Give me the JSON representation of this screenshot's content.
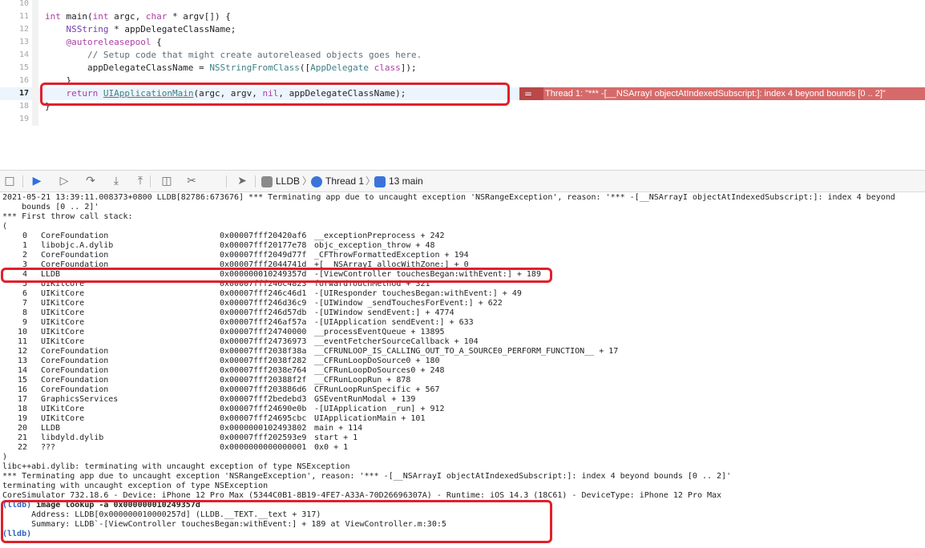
{
  "editor": {
    "lines": [
      {
        "n": "10",
        "parts": []
      },
      {
        "n": "11",
        "parts": [
          {
            "t": "int ",
            "c": "kw"
          },
          {
            "t": "main(",
            "c": "pl"
          },
          {
            "t": "int ",
            "c": "kw"
          },
          {
            "t": "argc, ",
            "c": "pl"
          },
          {
            "t": "char ",
            "c": "kw"
          },
          {
            "t": "* argv[]) {",
            "c": "pl"
          }
        ]
      },
      {
        "n": "12",
        "parts": [
          {
            "t": "    ",
            "c": "pl"
          },
          {
            "t": "NSString",
            "c": "cls"
          },
          {
            "t": " * appDelegateClassName;",
            "c": "pl"
          }
        ]
      },
      {
        "n": "13",
        "parts": [
          {
            "t": "    ",
            "c": "pl"
          },
          {
            "t": "@autoreleasepool",
            "c": "kw"
          },
          {
            "t": " {",
            "c": "pl"
          }
        ]
      },
      {
        "n": "14",
        "parts": [
          {
            "t": "        ",
            "c": "pl"
          },
          {
            "t": "// Setup code that might create autoreleased objects goes here.",
            "c": "cm"
          }
        ]
      },
      {
        "n": "15",
        "parts": [
          {
            "t": "        appDelegateClassName = ",
            "c": "pl"
          },
          {
            "t": "NSStringFromClass",
            "c": "fn"
          },
          {
            "t": "([",
            "c": "pl"
          },
          {
            "t": "AppDelegate",
            "c": "ty"
          },
          {
            "t": " ",
            "c": "pl"
          },
          {
            "t": "class",
            "c": "kw"
          },
          {
            "t": "]);",
            "c": "pl"
          }
        ]
      },
      {
        "n": "16",
        "parts": [
          {
            "t": "    }",
            "c": "pl"
          }
        ]
      },
      {
        "n": "17",
        "parts": [
          {
            "t": "    ",
            "c": "pl"
          },
          {
            "t": "return ",
            "c": "kw"
          },
          {
            "t": "UIApplicationMain",
            "c": "fn und"
          },
          {
            "t": "(argc, argv, ",
            "c": "pl"
          },
          {
            "t": "nil",
            "c": "kw"
          },
          {
            "t": ", appDelegateClassName);",
            "c": "pl"
          }
        ],
        "current": true
      },
      {
        "n": "18",
        "parts": [
          {
            "t": "}",
            "c": "pl"
          }
        ]
      },
      {
        "n": "19",
        "parts": []
      }
    ],
    "error_icon": "=",
    "error_message": "Thread 1: \"*** -[__NSArrayI objectAtIndexedSubscript:]: index 4 beyond bounds [0 .. 2]\""
  },
  "debugbar": {
    "buttons": [
      {
        "name": "hide-debug-area-button",
        "glyph": "□"
      },
      {
        "name": "breakpoints-toggle-button",
        "glyph": "▶"
      },
      {
        "name": "continue-button",
        "glyph": "▷"
      },
      {
        "name": "step-over-button",
        "glyph": "↷"
      },
      {
        "name": "step-into-button",
        "glyph": "⤓"
      },
      {
        "name": "step-out-button",
        "glyph": "⤒"
      },
      {
        "name": "debug-view-hierarchy-button",
        "glyph": "◫"
      },
      {
        "name": "memory-graph-button",
        "glyph": "✂"
      },
      {
        "name": "simulate-location-button",
        "glyph": "➤"
      }
    ],
    "crumbs": {
      "target": "LLDB",
      "thread": "Thread 1",
      "frame": "13 main"
    },
    "colors": {
      "thread_icon": "#3a74d9",
      "frame_icon": "#3a74d9",
      "target_icon": "#8a8a8a"
    }
  },
  "console": {
    "header_lines": [
      "2021-05-21 13:39:11.008373+0800 LLDB[82786:673676] *** Terminating app due to uncaught exception 'NSRangeException', reason: '*** -[__NSArrayI objectAtIndexedSubscript:]: index 4 beyond",
      "    bounds [0 .. 2]'",
      "*** First throw call stack:",
      "("
    ],
    "frames": [
      {
        "idx": "0",
        "lib": "CoreFoundation",
        "addr": "0x00007fff20420af6",
        "sym": "__exceptionPreprocess + 242"
      },
      {
        "idx": "1",
        "lib": "libobjc.A.dylib",
        "addr": "0x00007fff20177e78",
        "sym": "objc_exception_throw + 48"
      },
      {
        "idx": "2",
        "lib": "CoreFoundation",
        "addr": "0x00007fff2049d77f",
        "sym": "_CFThrowFormattedException + 194"
      },
      {
        "idx": "3",
        "lib": "CoreFoundation",
        "addr": "0x00007fff2044741d",
        "sym": "+[__NSArrayI allocWithZone:] + 0"
      },
      {
        "idx": "4",
        "lib": "LLDB",
        "addr": "0x000000010249357d",
        "sym": "-[ViewController touchesBegan:withEvent:] + 189"
      },
      {
        "idx": "5",
        "lib": "UIKitCore",
        "addr": "0x00007fff246c4823",
        "sym": "forwardTouchMethod + 321"
      },
      {
        "idx": "6",
        "lib": "UIKitCore",
        "addr": "0x00007fff246c46d1",
        "sym": "-[UIResponder touchesBegan:withEvent:] + 49"
      },
      {
        "idx": "7",
        "lib": "UIKitCore",
        "addr": "0x00007fff246d36c9",
        "sym": "-[UIWindow _sendTouchesForEvent:] + 622"
      },
      {
        "idx": "8",
        "lib": "UIKitCore",
        "addr": "0x00007fff246d57db",
        "sym": "-[UIWindow sendEvent:] + 4774"
      },
      {
        "idx": "9",
        "lib": "UIKitCore",
        "addr": "0x00007fff246af57a",
        "sym": "-[UIApplication sendEvent:] + 633"
      },
      {
        "idx": "10",
        "lib": "UIKitCore",
        "addr": "0x00007fff24740000",
        "sym": "__processEventQueue + 13895"
      },
      {
        "idx": "11",
        "lib": "UIKitCore",
        "addr": "0x00007fff24736973",
        "sym": "__eventFetcherSourceCallback + 104"
      },
      {
        "idx": "12",
        "lib": "CoreFoundation",
        "addr": "0x00007fff2038f38a",
        "sym": "__CFRUNLOOP_IS_CALLING_OUT_TO_A_SOURCE0_PERFORM_FUNCTION__ + 17"
      },
      {
        "idx": "13",
        "lib": "CoreFoundation",
        "addr": "0x00007fff2038f282",
        "sym": "__CFRunLoopDoSource0 + 180"
      },
      {
        "idx": "14",
        "lib": "CoreFoundation",
        "addr": "0x00007fff2038e764",
        "sym": "__CFRunLoopDoSources0 + 248"
      },
      {
        "idx": "15",
        "lib": "CoreFoundation",
        "addr": "0x00007fff20388f2f",
        "sym": "__CFRunLoopRun + 878"
      },
      {
        "idx": "16",
        "lib": "CoreFoundation",
        "addr": "0x00007fff203886d6",
        "sym": "CFRunLoopRunSpecific + 567"
      },
      {
        "idx": "17",
        "lib": "GraphicsServices",
        "addr": "0x00007fff2bedebd3",
        "sym": "GSEventRunModal + 139"
      },
      {
        "idx": "18",
        "lib": "UIKitCore",
        "addr": "0x00007fff24690e0b",
        "sym": "-[UIApplication _run] + 912"
      },
      {
        "idx": "19",
        "lib": "UIKitCore",
        "addr": "0x00007fff24695cbc",
        "sym": "UIApplicationMain + 101"
      },
      {
        "idx": "20",
        "lib": "LLDB",
        "addr": "0x0000000102493802",
        "sym": "main + 114"
      },
      {
        "idx": "21",
        "lib": "libdyld.dylib",
        "addr": "0x00007fff202593e9",
        "sym": "start + 1"
      },
      {
        "idx": "22",
        "lib": "???",
        "addr": "0x0000000000000001",
        "sym": "0x0 + 1"
      }
    ],
    "footer_lines": [
      ")",
      "libc++abi.dylib: terminating with uncaught exception of type NSException",
      "*** Terminating app due to uncaught exception 'NSRangeException', reason: '*** -[__NSArrayI objectAtIndexedSubscript:]: index 4 beyond bounds [0 .. 2]'",
      "terminating with uncaught exception of type NSException",
      "CoreSimulator 732.18.6 - Device: iPhone 12 Pro Max (5344C0B1-8B19-4FE7-A33A-70D26696307A) - Runtime: iOS 14.3 (18C61) - DeviceType: iPhone 12 Pro Max"
    ],
    "prompt": "(lldb)",
    "command": " image lookup -a 0x000000010249357d",
    "result_lines": [
      "      Address: LLDB[0x000000010000257d] (LLDB.__TEXT.__text + 317)",
      "      Summary: LLDB`-[ViewController touchesBegan:withEvent:] + 189 at ViewController.m:30:5"
    ],
    "final_prompt": "(lldb)"
  }
}
